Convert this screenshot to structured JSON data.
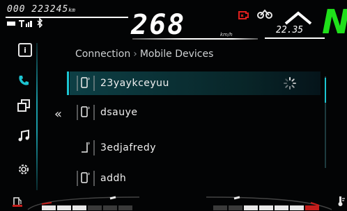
{
  "status": {
    "odometer": "000 223245",
    "odometer_unit": "km",
    "speed": "268",
    "speed_unit": "km/h",
    "clock": "22.35",
    "gear": "N",
    "bluetooth_icon": "bluetooth-icon",
    "signal_icon": "signal-bars-icon",
    "battery_icon": "battery-icon",
    "warning_red_icon": "engine-warning-icon",
    "warning_white_icon": "traction-control-icon"
  },
  "colors": {
    "accent": "#1cc5d2",
    "gear": "#1fe01a",
    "warning": "#e0201e"
  },
  "nav": [
    {
      "name": "info",
      "icon": "info-icon",
      "active": false
    },
    {
      "name": "phone",
      "icon": "phone-icon",
      "active": true
    },
    {
      "name": "screens",
      "icon": "overlap-squares-icon",
      "active": false
    },
    {
      "name": "music",
      "icon": "music-note-icon",
      "active": false
    },
    {
      "name": "settings",
      "icon": "gear-settings-icon",
      "active": false
    }
  ],
  "breadcrumb": {
    "parent": "Connection",
    "separator": "›",
    "current": "Mobile Devices"
  },
  "devices": [
    {
      "label": "23yaykceyuu",
      "selected": true,
      "connecting": true
    },
    {
      "label": "dsauye",
      "selected": false,
      "connecting": false
    },
    {
      "label": "3edjafredy",
      "selected": false,
      "connecting": false
    },
    {
      "label": "addh",
      "selected": false,
      "connecting": false
    }
  ],
  "back_glyph": "«"
}
